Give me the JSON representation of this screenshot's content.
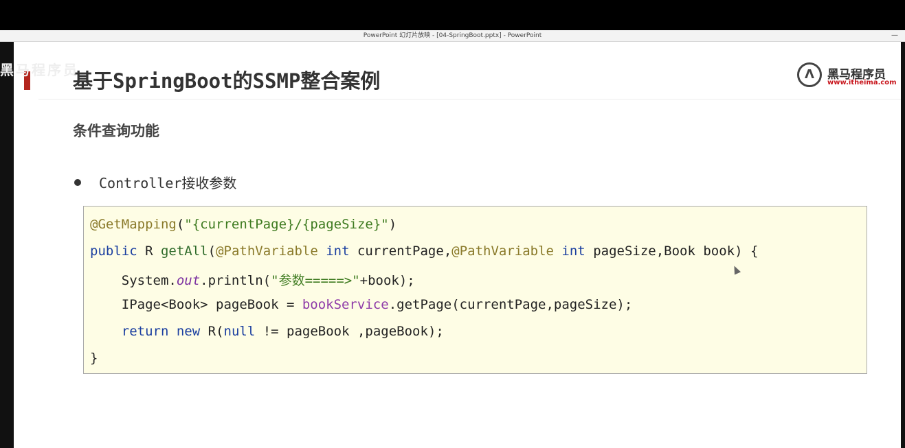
{
  "window": {
    "title": "PowerPoint 幻灯片放映 - [04-SpringBoot.pptx] - PowerPoint",
    "minimize_glyph": "—"
  },
  "watermark": {
    "text": "黑马程序员"
  },
  "slide": {
    "title": "基于SpringBoot的SSMP整合案例",
    "logo": {
      "name": "黑马程序员",
      "url": "www.itheima.com"
    },
    "subtitle": "条件查询功能",
    "bullet": "Controller接收参数",
    "code": {
      "l1_ann": "@GetMapping",
      "l1_paren_open": "(",
      "l1_str": "\"{currentPage}/{pageSize}\"",
      "l1_paren_close": ")",
      "l2_kw_public": "public",
      "l2_type": " R ",
      "l2_method": "getAll",
      "l2_p1": "(",
      "l2_ann1": "@PathVariable",
      "l2_kw_int1": " int",
      "l2_p2": " currentPage,",
      "l2_ann2": "@PathVariable",
      "l2_kw_int2": " int",
      "l2_p3": " pageSize,Book book) {",
      "l3_a": "    System.",
      "l3_out": "out",
      "l3_b": ".println(",
      "l3_str": "\"参数=====>\"",
      "l3_c": "+book);",
      "l4_a": "    IPage<Book> pageBook = ",
      "l4_field": "bookService",
      "l4_b": ".getPage(currentPage,pageSize);",
      "l5_indent": "    ",
      "l5_kw_return": "return",
      "l5_sp": " ",
      "l5_kw_new": "new",
      "l5_a": " R(",
      "l5_kw_null": "null",
      "l5_b": " != pageBook ,pageBook);",
      "l6": "}"
    }
  }
}
